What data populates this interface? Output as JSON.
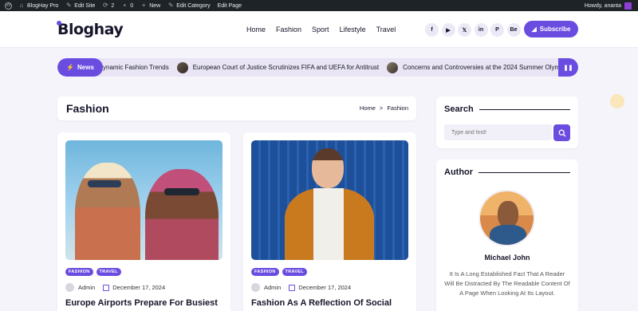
{
  "admin_bar": {
    "site_name": "BlogHay Pro",
    "edit_site": "Edit Site",
    "updates_count": "2",
    "comments_count": "0",
    "new_label": "New",
    "edit_category": "Edit Category",
    "edit_page": "Edit Page",
    "greeting": "Howdy, ananta"
  },
  "header": {
    "logo_text": "Bloghay",
    "nav": [
      "Home",
      "Fashion",
      "Sport",
      "Lifestyle",
      "Travel"
    ],
    "socials": [
      {
        "icon": "facebook-icon",
        "glyph": "f"
      },
      {
        "icon": "youtube-icon",
        "glyph": "▶"
      },
      {
        "icon": "x-icon",
        "glyph": "𝕏"
      },
      {
        "icon": "linkedin-icon",
        "glyph": "in"
      },
      {
        "icon": "pinterest-icon",
        "glyph": "P"
      },
      {
        "icon": "behance-icon",
        "glyph": "Be"
      }
    ],
    "subscribe_label": "Subscribe"
  },
  "ticker": {
    "label": "News",
    "items": [
      "ynamic Fashion Trends",
      "European Court of Justice Scrutinizes FIFA and UEFA for Antitrust",
      "Concerns and Controversies at the 2024 Summer Olymp"
    ]
  },
  "page": {
    "title": "Fashion",
    "breadcrumb_home": "Home",
    "breadcrumb_sep": ">",
    "breadcrumb_current": "Fashion"
  },
  "posts": [
    {
      "tags": [
        "FASHION",
        "TRAVEL"
      ],
      "author": "Admin",
      "date": "December 17, 2024",
      "title": "Europe Airports Prepare For Busiest"
    },
    {
      "tags": [
        "FASHION",
        "TRAVEL"
      ],
      "author": "Admin",
      "date": "December 17, 2024",
      "title": "Fashion As A Reflection Of Social"
    }
  ],
  "sidebar": {
    "search_title": "Search",
    "search_placeholder": "Type and find!",
    "author_title": "Author",
    "author_name": "Michael John",
    "author_bio": "It Is A Long Established Fact That A Reader Will Be Distracted By The Readable Content Of A Page When Looking At Its Layout."
  },
  "colors": {
    "accent": "#6a4ce0",
    "background": "#f6f4fb",
    "admin_bar": "#1d2327"
  }
}
